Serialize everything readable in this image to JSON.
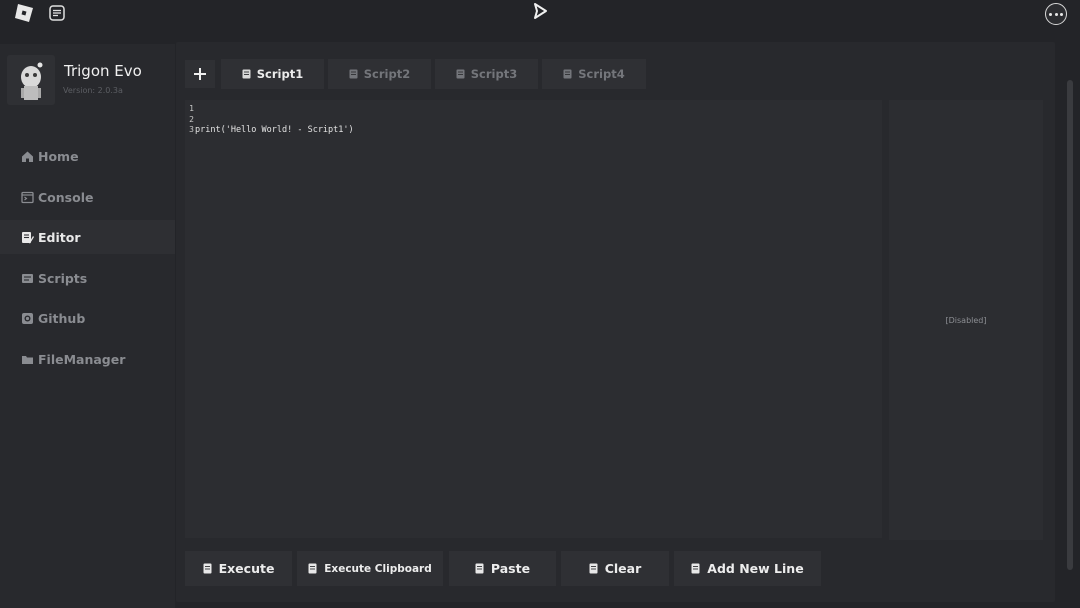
{
  "app": {
    "name": "Trigon Evo",
    "version": "Version: 2.0.3a"
  },
  "sidebar": {
    "items": [
      {
        "label": "Home",
        "icon": "home-icon",
        "active": false
      },
      {
        "label": "Console",
        "icon": "console-icon",
        "active": false
      },
      {
        "label": "Editor",
        "icon": "editor-icon",
        "active": true
      },
      {
        "label": "Scripts",
        "icon": "scripts-icon",
        "active": false
      },
      {
        "label": "Github",
        "icon": "github-icon",
        "active": false
      },
      {
        "label": "FileManager",
        "icon": "folder-icon",
        "active": false
      }
    ]
  },
  "tabs": [
    {
      "label": "Script1",
      "active": true
    },
    {
      "label": "Script2",
      "active": false
    },
    {
      "label": "Script3",
      "active": false
    },
    {
      "label": "Script4",
      "active": false
    }
  ],
  "editor": {
    "line_numbers": [
      "1",
      "2",
      "3"
    ],
    "lines": [
      "print('Hello World! - Script1')",
      "",
      ""
    ]
  },
  "side_panel": {
    "status": "[Disabled]"
  },
  "actions": [
    {
      "label": "Execute"
    },
    {
      "label": "Execute Clipboard"
    },
    {
      "label": "Paste"
    },
    {
      "label": "Clear"
    },
    {
      "label": "Add New Line"
    }
  ],
  "colors": {
    "background": "#232428",
    "panel": "#28292d",
    "button": "#2f3034",
    "editor": "#2c2d31",
    "text_active": "#ececec",
    "text_inactive": "#8a8c91"
  }
}
